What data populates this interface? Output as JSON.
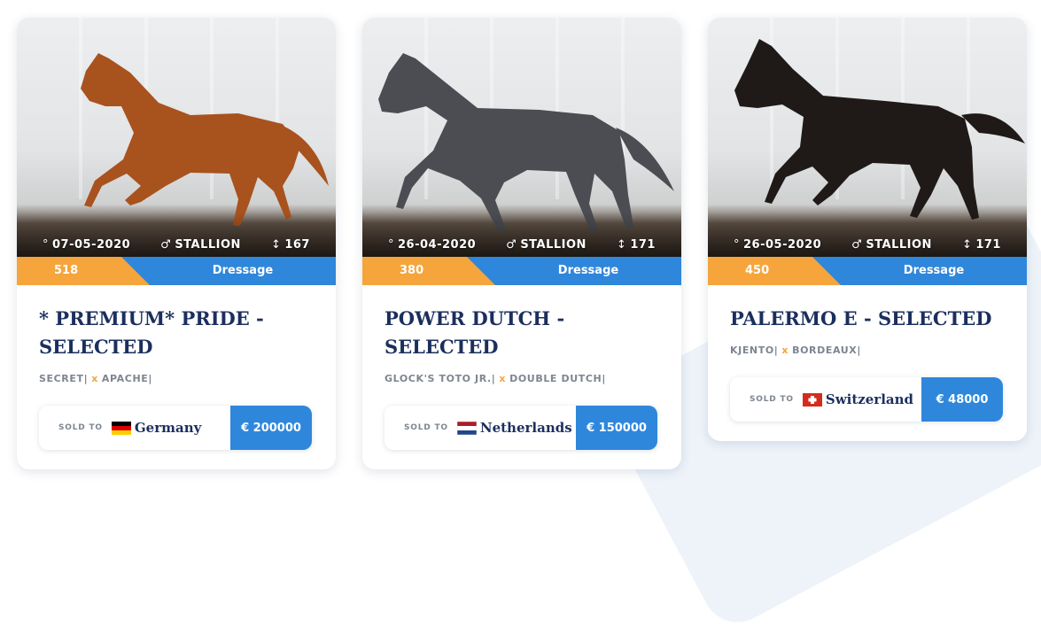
{
  "cards": [
    {
      "date": "07-05-2020",
      "sex": "STALLION",
      "height": "167",
      "score": "518",
      "discipline": "Dressage",
      "title": "* PREMIUM* PRIDE - SELECTED",
      "sire": "SECRET|",
      "dam": "APACHE|",
      "separator": "x",
      "sold_label": "SOLD TO",
      "country": "Germany",
      "price": "€ 200000",
      "horse_color": "#a8521e"
    },
    {
      "date": "26-04-2020",
      "sex": "STALLION",
      "height": "171",
      "score": "380",
      "discipline": "Dressage",
      "title": "POWER DUTCH - SELECTED",
      "sire": "GLOCK'S TOTO JR.|",
      "dam": "DOUBLE DUTCH|",
      "separator": "x",
      "sold_label": "SOLD TO",
      "country": "Netherlands",
      "price": "€ 150000",
      "horse_color": "#4b4d52"
    },
    {
      "date": "26-05-2020",
      "sex": "STALLION",
      "height": "171",
      "score": "450",
      "discipline": "Dressage",
      "title": "PALERMO E - SELECTED",
      "sire": "KJENTO|",
      "dam": "BORDEAUX|",
      "separator": "x",
      "sold_label": "SOLD TO",
      "country": "Switzerland",
      "price": "€ 48000",
      "horse_color": "#1f1a18"
    }
  ],
  "icons": {
    "date": "calendar-dot-icon",
    "sex": "male-icon",
    "height": "height-icon"
  },
  "colors": {
    "accent": "#2f87db",
    "score": "#f5a53b",
    "title": "#1b2f5e"
  }
}
